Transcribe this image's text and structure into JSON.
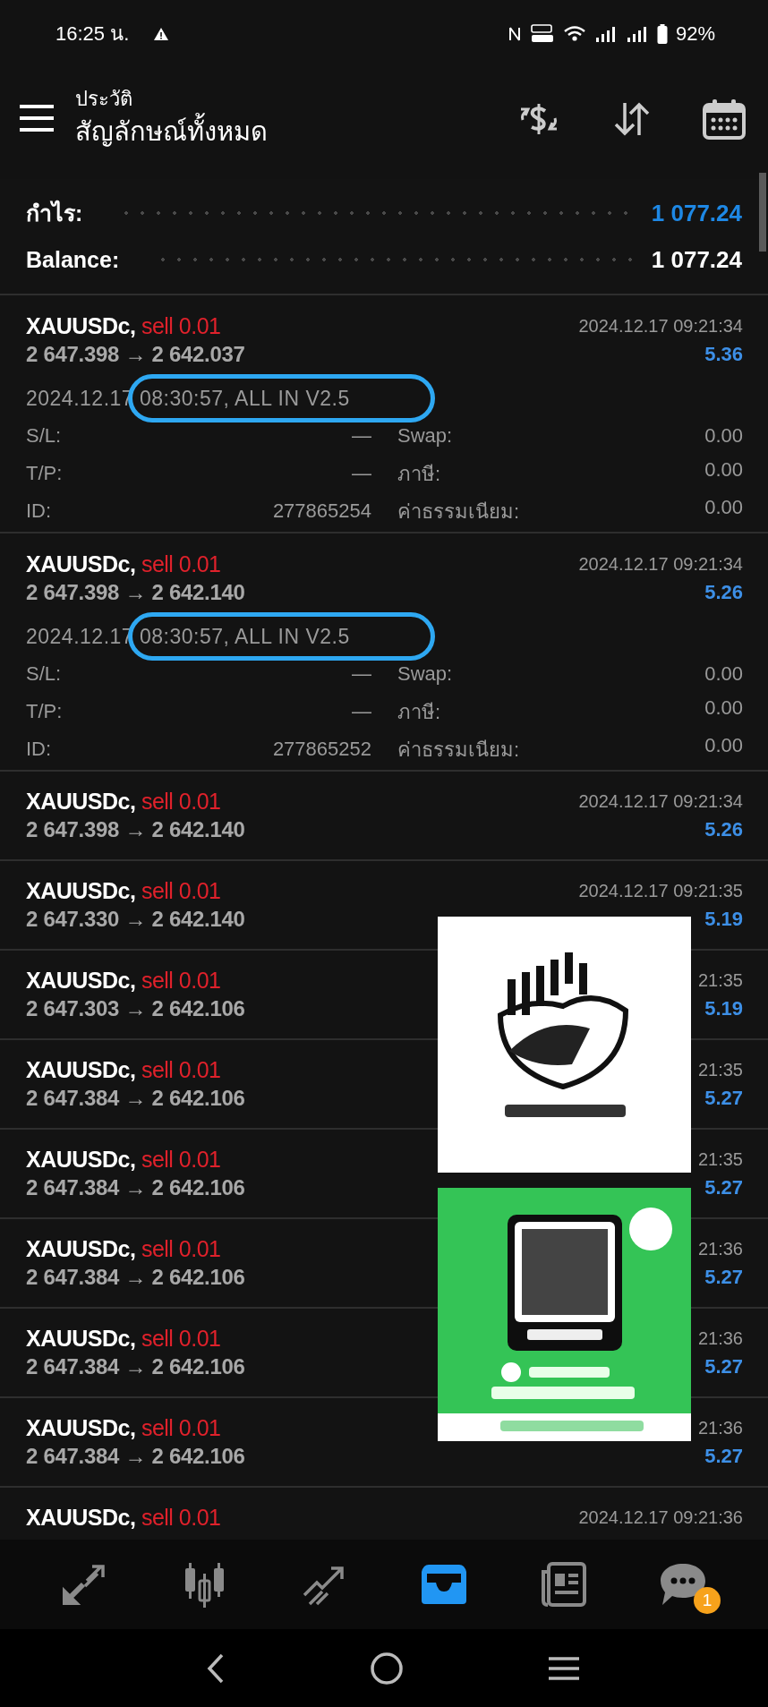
{
  "status_bar": {
    "time": "16:25 น.",
    "battery": "92%"
  },
  "header": {
    "subtitle": "ประวัติ",
    "title": "สัญลักษณ์ทั้งหมด"
  },
  "summary": [
    {
      "label": "กำไร:",
      "value": "1 077.24",
      "kind": "profit"
    },
    {
      "label": "Balance:",
      "value": "1 077.24",
      "kind": "plain"
    }
  ],
  "trades": [
    {
      "symbol": "XAUUSDc,",
      "side": "sell 0.01",
      "prices": "2 647.398 → 2 642.037",
      "time": "2024.12.17 09:21:34",
      "profit": "5.36",
      "comment": "2024.12.17 08:30:57, ALL IN V2.5",
      "highlighted": true,
      "details": [
        [
          "S/L:",
          "—",
          "Swap:",
          "0.00"
        ],
        [
          "T/P:",
          "—",
          "ภาษี:",
          "0.00"
        ],
        [
          "ID:",
          "277865254",
          "ค่าธรรมเนียม:",
          "0.00"
        ]
      ]
    },
    {
      "symbol": "XAUUSDc,",
      "side": "sell 0.01",
      "prices": "2 647.398 → 2 642.140",
      "time": "2024.12.17 09:21:34",
      "profit": "5.26",
      "comment": "2024.12.17 08:30:57, ALL IN V2.5",
      "highlighted": true,
      "details": [
        [
          "S/L:",
          "—",
          "Swap:",
          "0.00"
        ],
        [
          "T/P:",
          "—",
          "ภาษี:",
          "0.00"
        ],
        [
          "ID:",
          "277865252",
          "ค่าธรรมเนียม:",
          "0.00"
        ]
      ]
    },
    {
      "symbol": "XAUUSDc,",
      "side": "sell 0.01",
      "prices": "2 647.398 → 2 642.140",
      "time": "2024.12.17 09:21:34",
      "profit": "5.26"
    },
    {
      "symbol": "XAUUSDc,",
      "side": "sell 0.01",
      "prices": "2 647.330 → 2 642.140",
      "time": "2024.12.17 09:21:35",
      "profit": "5.19"
    },
    {
      "symbol": "XAUUSDc,",
      "side": "sell 0.01",
      "prices": "2 647.303 → 2 642.106",
      "time": "21:35",
      "profit": "5.19"
    },
    {
      "symbol": "XAUUSDc,",
      "side": "sell 0.01",
      "prices": "2 647.384 → 2 642.106",
      "time": "21:35",
      "profit": "5.27"
    },
    {
      "symbol": "XAUUSDc,",
      "side": "sell 0.01",
      "prices": "2 647.384 → 2 642.106",
      "time": "21:35",
      "profit": "5.27"
    },
    {
      "symbol": "XAUUSDc,",
      "side": "sell 0.01",
      "prices": "2 647.384 → 2 642.106",
      "time": "21:36",
      "profit": "5.27"
    },
    {
      "symbol": "XAUUSDc,",
      "side": "sell 0.01",
      "prices": "2 647.384 → 2 642.106",
      "time": "21:36",
      "profit": "5.27"
    },
    {
      "symbol": "XAUUSDc,",
      "side": "sell 0.01",
      "prices": "2 647.384 → 2 642.106",
      "time": "21:36",
      "profit": "5.27"
    },
    {
      "symbol": "XAUUSDc,",
      "side": "sell 0.01",
      "time": "2024.12.17 09:21:36"
    }
  ],
  "bottom_nav": [
    {
      "kind": "trade",
      "selected": false
    },
    {
      "kind": "quotes",
      "selected": false
    },
    {
      "kind": "chart",
      "selected": false
    },
    {
      "kind": "history",
      "selected": true
    },
    {
      "kind": "news",
      "selected": false
    },
    {
      "kind": "chat",
      "selected": false,
      "badge": "1"
    }
  ]
}
